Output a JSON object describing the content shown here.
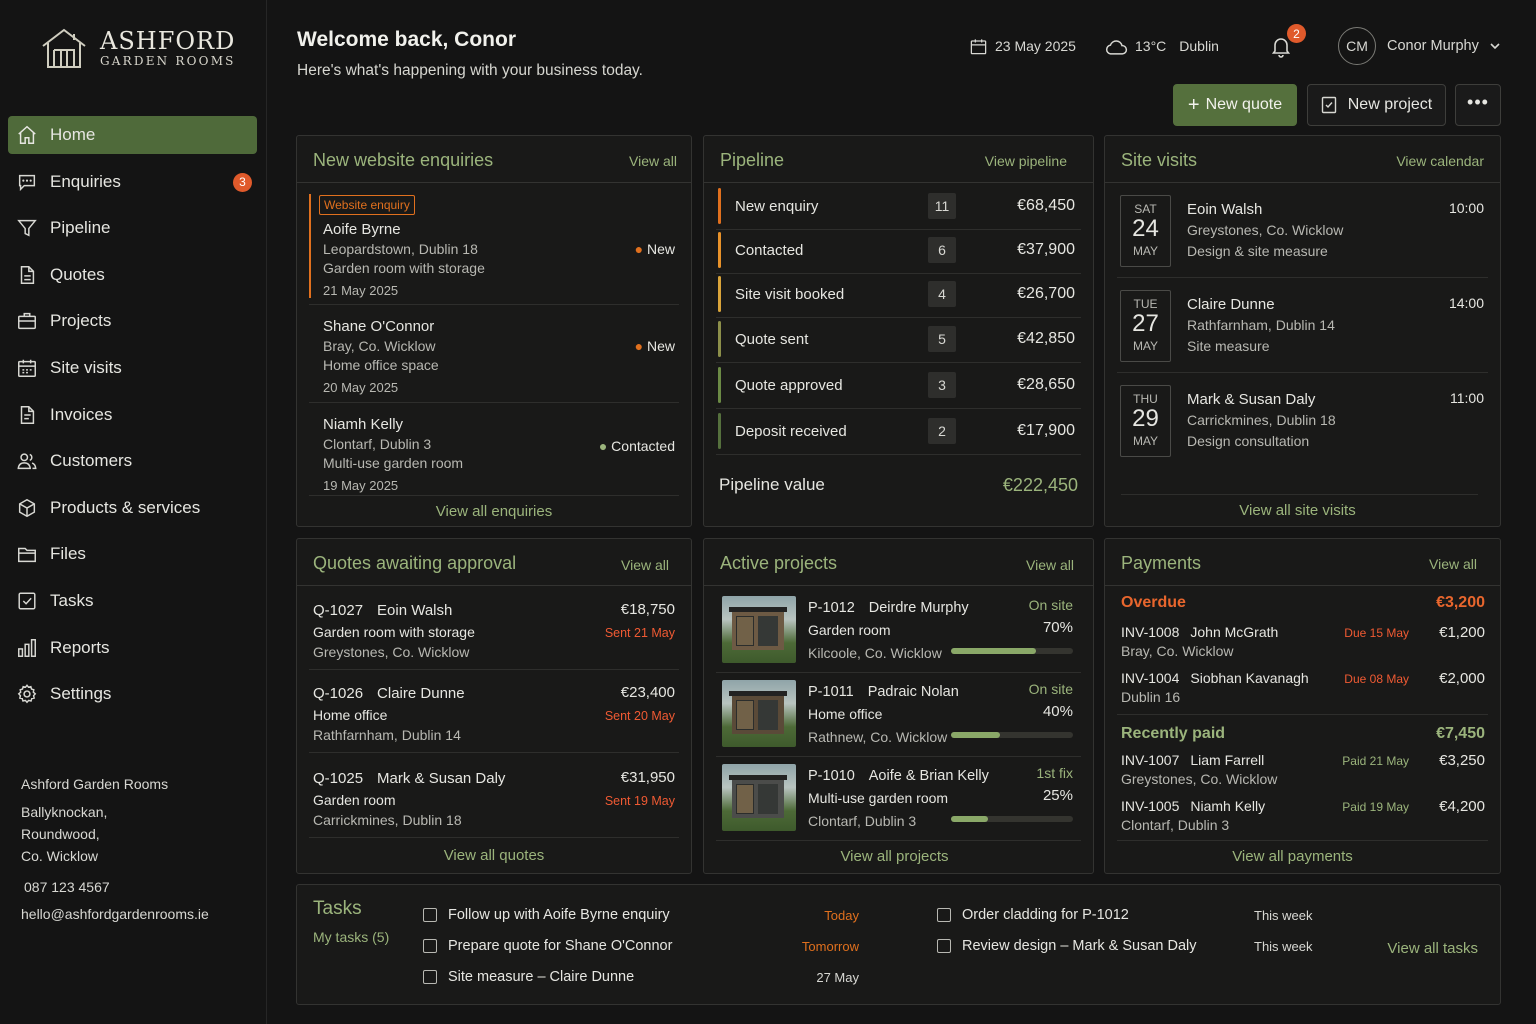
{
  "brand": {
    "name": "ASHFORD",
    "subtitle": "GARDEN ROOMS"
  },
  "nav": [
    {
      "label": "Home",
      "icon": "home-icon",
      "active": true
    },
    {
      "label": "Enquiries",
      "icon": "chat-icon",
      "badge": "3"
    },
    {
      "label": "Pipeline",
      "icon": "funnel-icon"
    },
    {
      "label": "Quotes",
      "icon": "document-icon"
    },
    {
      "label": "Projects",
      "icon": "briefcase-icon"
    },
    {
      "label": "Site visits",
      "icon": "calendar-icon"
    },
    {
      "label": "Invoices",
      "icon": "invoice-icon"
    },
    {
      "label": "Customers",
      "icon": "users-icon"
    },
    {
      "label": "Products & services",
      "icon": "box-icon"
    },
    {
      "label": "Files",
      "icon": "folder-icon"
    },
    {
      "label": "Tasks",
      "icon": "checkbox-icon"
    },
    {
      "label": "Reports",
      "icon": "bar-chart-icon"
    },
    {
      "label": "Settings",
      "icon": "gear-icon"
    }
  ],
  "company": {
    "name": "Ashford Garden Rooms",
    "address1": "Ballyknockan,",
    "address2": "Roundwood,",
    "address3": "Co. Wicklow",
    "phone": "087 123 4567",
    "email": "hello@ashfordgardenrooms.ie"
  },
  "header": {
    "title": "Welcome back, Conor",
    "subtitle": "Here's what's happening with your business today.",
    "date": "23 May 2025",
    "temp": "13°C",
    "city": "Dublin",
    "notifications": "2",
    "initials": "CM",
    "user": "Conor Murphy",
    "new_quote": "New quote",
    "new_project": "New project"
  },
  "enquiries": {
    "title": "New website enquiries",
    "view_all": "View all",
    "tag": "Website enquiry",
    "items": [
      {
        "name": "Aoife Byrne",
        "location": "Leopardstown, Dublin 18",
        "desc": "Garden room with storage",
        "date": "21 May 2025",
        "status": "New"
      },
      {
        "name": "Shane O'Connor",
        "location": "Bray, Co. Wicklow",
        "desc": "Home office space",
        "date": "20 May 2025",
        "status": "New"
      },
      {
        "name": "Niamh Kelly",
        "location": "Clontarf, Dublin 3",
        "desc": "Multi-use garden room",
        "date": "19 May 2025",
        "status": "Contacted"
      }
    ],
    "footer": "View all enquiries"
  },
  "pipeline": {
    "title": "Pipeline",
    "view": "View pipeline",
    "stages": [
      {
        "label": "New enquiry",
        "count": "11",
        "amount": "€68,450",
        "color": "#e0701e"
      },
      {
        "label": "Contacted",
        "count": "6",
        "amount": "€37,900",
        "color": "#e8922a"
      },
      {
        "label": "Site visit booked",
        "count": "4",
        "amount": "€26,700",
        "color": "#d9a43a"
      },
      {
        "label": "Quote sent",
        "count": "5",
        "amount": "€42,850",
        "color": "#8c8f4a"
      },
      {
        "label": "Quote approved",
        "count": "3",
        "amount": "€28,650",
        "color": "#6b8a45"
      },
      {
        "label": "Deposit received",
        "count": "2",
        "amount": "€17,900",
        "color": "#55703d"
      }
    ],
    "total_label": "Pipeline value",
    "total": "€222,450"
  },
  "visits": {
    "title": "Site visits",
    "view": "View calendar",
    "items": [
      {
        "day": "SAT",
        "num": "24",
        "month": "MAY",
        "name": "Eoin Walsh",
        "location": "Greystones, Co. Wicklow",
        "type": "Design & site measure",
        "time": "10:00"
      },
      {
        "day": "TUE",
        "num": "27",
        "month": "MAY",
        "name": "Claire Dunne",
        "location": "Rathfarnham, Dublin 14",
        "type": "Site measure",
        "time": "14:00"
      },
      {
        "day": "THU",
        "num": "29",
        "month": "MAY",
        "name": "Mark & Susan Daly",
        "location": "Carrickmines, Dublin 18",
        "type": "Design consultation",
        "time": "11:00"
      }
    ],
    "footer": "View all site visits"
  },
  "quotes": {
    "title": "Quotes awaiting approval",
    "view_all": "View all",
    "items": [
      {
        "id": "Q-1027",
        "name": "Eoin Walsh",
        "desc": "Garden room with storage",
        "location": "Greystones, Co. Wicklow",
        "amount": "€18,750",
        "sent": "Sent 21 May"
      },
      {
        "id": "Q-1026",
        "name": "Claire Dunne",
        "desc": "Home office",
        "location": "Rathfarnham, Dublin 14",
        "amount": "€23,400",
        "sent": "Sent 20 May"
      },
      {
        "id": "Q-1025",
        "name": "Mark & Susan Daly",
        "desc": "Garden room",
        "location": "Carrickmines, Dublin 18",
        "amount": "€31,950",
        "sent": "Sent 19 May"
      }
    ],
    "footer": "View all quotes"
  },
  "projects": {
    "title": "Active projects",
    "view_all": "View all",
    "items": [
      {
        "id": "P-1012",
        "name": "Deirdre Murphy",
        "desc": "Garden room",
        "location": "Kilcoole, Co. Wicklow",
        "stage": "On site",
        "progress": "70%",
        "fraction": 0.7
      },
      {
        "id": "P-1011",
        "name": "Padraic Nolan",
        "desc": "Home office",
        "location": "Rathnew, Co. Wicklow",
        "stage": "On site",
        "progress": "40%",
        "fraction": 0.4
      },
      {
        "id": "P-1010",
        "name": "Aoife & Brian Kelly",
        "desc": "Multi-use garden room",
        "location": "Clontarf, Dublin 3",
        "stage": "1st fix",
        "progress": "25%",
        "fraction": 0.3
      }
    ],
    "footer": "View all projects"
  },
  "payments": {
    "title": "Payments",
    "view_all": "View all",
    "overdue_label": "Overdue",
    "overdue_total": "€3,200",
    "overdue": [
      {
        "inv": "INV-1008",
        "name": "John McGrath",
        "location": "Bray, Co. Wicklow",
        "due": "Due 15 May",
        "amount": "€1,200"
      },
      {
        "inv": "INV-1004",
        "name": "Siobhan Kavanagh",
        "location": "Dublin 16",
        "due": "Due 08 May",
        "amount": "€2,000"
      }
    ],
    "paid_label": "Recently paid",
    "paid_total": "€7,450",
    "paid": [
      {
        "inv": "INV-1007",
        "name": "Liam Farrell",
        "location": "Greystones, Co. Wicklow",
        "date": "Paid 21 May",
        "amount": "€3,250"
      },
      {
        "inv": "INV-1005",
        "name": "Niamh Kelly",
        "location": "Clontarf, Dublin 3",
        "date": "Paid 19 May",
        "amount": "€4,200"
      }
    ],
    "footer": "View all payments"
  },
  "tasks": {
    "title": "Tasks",
    "mine": "My tasks (5)",
    "col1": [
      {
        "label": "Follow up with Aoife Byrne enquiry",
        "due": "Today"
      },
      {
        "label": "Prepare quote for Shane O'Connor",
        "due": "Tomorrow"
      },
      {
        "label": "Site measure – Claire Dunne",
        "due": "27 May"
      }
    ],
    "col2": [
      {
        "label": "Order cladding for P-1012",
        "due": "This week"
      },
      {
        "label": "Review design – Mark & Susan Daly",
        "due": "This week"
      }
    ],
    "footer": "View all tasks"
  }
}
